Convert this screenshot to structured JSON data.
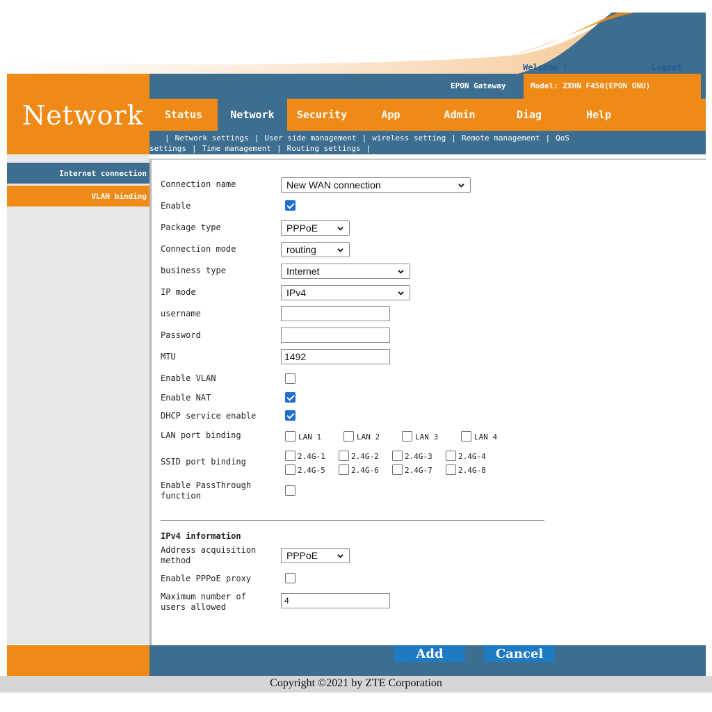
{
  "header": {
    "welcome": "Welcome !",
    "logout": "Logout",
    "gateway": "EPON Gateway",
    "model": "Model: ZXHN F450(EPON ONU)",
    "section_title": "Network"
  },
  "nav": {
    "tabs": [
      {
        "label": "Status",
        "active": false
      },
      {
        "label": "Network",
        "active": true
      },
      {
        "label": "Security",
        "active": false
      },
      {
        "label": "App",
        "active": false
      },
      {
        "label": "Admin",
        "active": false
      },
      {
        "label": "Diag",
        "active": false
      },
      {
        "label": "Help",
        "active": false
      }
    ],
    "sub": {
      "network_settings": "Network settings",
      "user_side": "User side management",
      "wireless": "wireless setting",
      "remote": "Remote management",
      "qos_a": "QoS",
      "qos_b": "settings",
      "time": "Time management",
      "routing": "Routing settings"
    }
  },
  "sidebar": {
    "items": [
      "Internet connection",
      "VLAN binding"
    ]
  },
  "form": {
    "connection_name": {
      "label": "Connection name",
      "value": "New WAN connection"
    },
    "enable": {
      "label": "Enable",
      "checked": true
    },
    "package_type": {
      "label": "Package type",
      "value": "PPPoE"
    },
    "connection_mode": {
      "label": "Connection mode",
      "value": "routing"
    },
    "business_type": {
      "label": "business type",
      "value": "Internet"
    },
    "ip_mode": {
      "label": "IP mode",
      "value": "IPv4"
    },
    "username": {
      "label": "username",
      "value": ""
    },
    "password": {
      "label": "Password",
      "value": ""
    },
    "mtu": {
      "label": "MTU",
      "value": "1492"
    },
    "enable_vlan": {
      "label": "Enable VLAN",
      "checked": false
    },
    "enable_nat": {
      "label": "Enable NAT",
      "checked": true
    },
    "dhcp": {
      "label": "DHCP service enable",
      "checked": true
    },
    "lan_binding": {
      "label": "LAN port binding",
      "ports": [
        "LAN 1",
        "LAN 2",
        "LAN 3",
        "LAN 4"
      ]
    },
    "ssid_binding": {
      "label": "SSID port binding",
      "ports": [
        "2.4G-1",
        "2.4G-2",
        "2.4G-3",
        "2.4G-4",
        "2.4G-5",
        "2.4G-6",
        "2.4G-7",
        "2.4G-8"
      ]
    },
    "passthrough": {
      "label_1": "Enable PassThrough",
      "label_2": "function",
      "checked": false
    }
  },
  "ipv4": {
    "title": "IPv4 information",
    "address_method": {
      "label_1": "Address acquisition",
      "label_2": "method",
      "value": "PPPoE"
    },
    "pppoe_proxy": {
      "label": "Enable PPPoE proxy",
      "checked": false
    },
    "max_users": {
      "label_1": "Maximum number of",
      "label_2": "users allowed",
      "value": "4"
    }
  },
  "buttons": {
    "add": "Add",
    "cancel": "Cancel"
  },
  "footer": {
    "copyright": "Copyright ©2021 by ZTE Corporation"
  },
  "colors": {
    "orange": "#f08a16",
    "blue": "#3d6d8f",
    "checkbox": "#1e6fd0",
    "button": "#1f7ac4"
  }
}
